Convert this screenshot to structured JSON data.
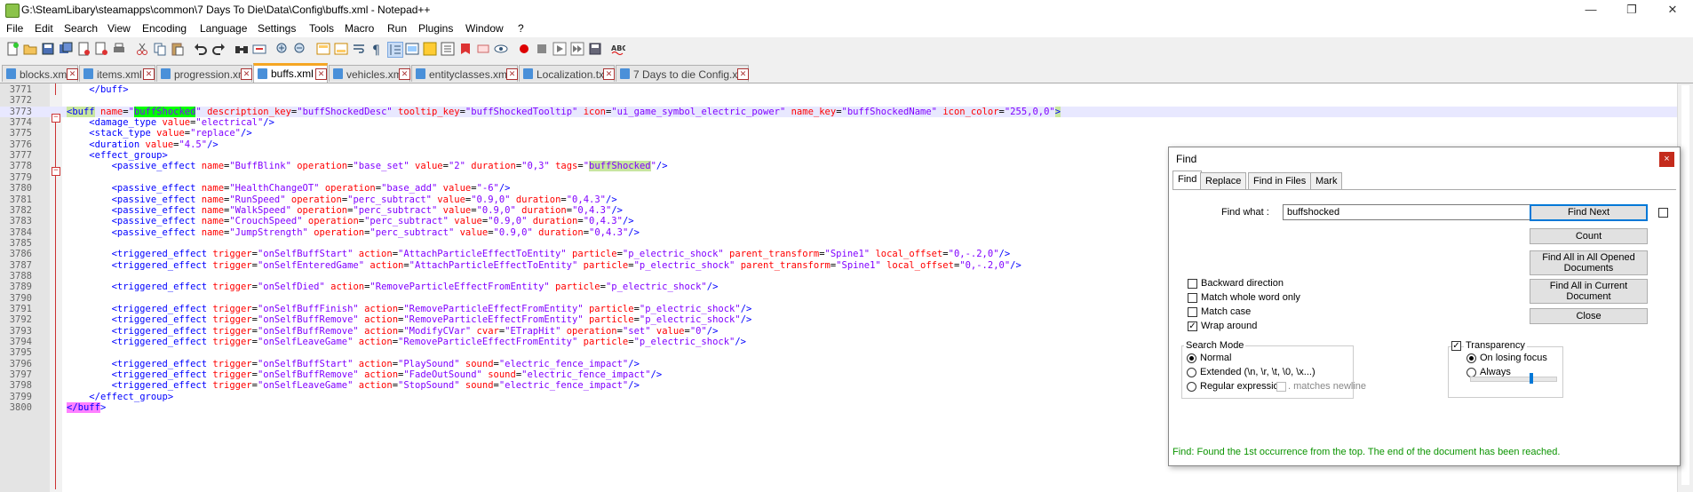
{
  "window": {
    "title": "G:\\SteamLibary\\steamapps\\common\\7 Days To Die\\Data\\Config\\buffs.xml - Notepad++",
    "controls": [
      "—",
      "❐",
      "✕"
    ]
  },
  "menu": [
    "File",
    "Edit",
    "Search",
    "View",
    "Encoding",
    "Language",
    "Settings",
    "Tools",
    "Macro",
    "Run",
    "Plugins",
    "Window",
    "?"
  ],
  "tabs": [
    {
      "label": "blocks.xml"
    },
    {
      "label": "items.xml"
    },
    {
      "label": "progression.xml"
    },
    {
      "label": "buffs.xml",
      "active": true
    },
    {
      "label": "vehicles.xml"
    },
    {
      "label": "entityclasses.xml"
    },
    {
      "label": "Localization.txt"
    },
    {
      "label": "7 Days to die Config.xml"
    }
  ],
  "editor": {
    "lines": [
      {
        "n": "3771",
        "text": "    </buff>"
      },
      {
        "n": "3772",
        "text": ""
      },
      {
        "n": "3773",
        "text": "<buff name=\"buffShocked\" description_key=\"buffShockedDesc\" tooltip_key=\"buffShockedTooltip\" icon=\"ui_game_symbol_electric_power\" name_key=\"buffShockedName\" icon_color=\"255,0,0\">"
      },
      {
        "n": "3774",
        "text": "    <damage_type value=\"electrical\"/>"
      },
      {
        "n": "3775",
        "text": "    <stack_type value=\"replace\"/>"
      },
      {
        "n": "3776",
        "text": "    <duration value=\"4.5\"/>"
      },
      {
        "n": "3777",
        "text": "    <effect_group>"
      },
      {
        "n": "3778",
        "text": "        <passive_effect name=\"BuffBlink\" operation=\"base_set\" value=\"2\" duration=\"0,3\" tags=\"buffShocked\"/>"
      },
      {
        "n": "3779",
        "text": ""
      },
      {
        "n": "3780",
        "text": "        <passive_effect name=\"HealthChangeOT\" operation=\"base_add\" value=\"-6\"/>"
      },
      {
        "n": "3781",
        "text": "        <passive_effect name=\"RunSpeed\" operation=\"perc_subtract\" value=\"0.9,0\" duration=\"0,4.3\"/>"
      },
      {
        "n": "3782",
        "text": "        <passive_effect name=\"WalkSpeed\" operation=\"perc_subtract\" value=\"0.9,0\" duration=\"0,4.3\"/>"
      },
      {
        "n": "3783",
        "text": "        <passive_effect name=\"CrouchSpeed\" operation=\"perc_subtract\" value=\"0.9,0\" duration=\"0,4.3\"/>"
      },
      {
        "n": "3784",
        "text": "        <passive_effect name=\"JumpStrength\" operation=\"perc_subtract\" value=\"0.9,0\" duration=\"0,4.3\"/>"
      },
      {
        "n": "3785",
        "text": ""
      },
      {
        "n": "3786",
        "text": "        <triggered_effect trigger=\"onSelfBuffStart\" action=\"AttachParticleEffectToEntity\" particle=\"p_electric_shock\" parent_transform=\"Spine1\" local_offset=\"0,-.2,0\"/>"
      },
      {
        "n": "3787",
        "text": "        <triggered_effect trigger=\"onSelfEnteredGame\" action=\"AttachParticleEffectToEntity\" particle=\"p_electric_shock\" parent_transform=\"Spine1\" local_offset=\"0,-.2,0\"/>"
      },
      {
        "n": "3788",
        "text": ""
      },
      {
        "n": "3789",
        "text": "        <triggered_effect trigger=\"onSelfDied\" action=\"RemoveParticleEffectFromEntity\" particle=\"p_electric_shock\"/>"
      },
      {
        "n": "3790",
        "text": ""
      },
      {
        "n": "3791",
        "text": "        <triggered_effect trigger=\"onSelfBuffFinish\" action=\"RemoveParticleEffectFromEntity\" particle=\"p_electric_shock\"/>"
      },
      {
        "n": "3792",
        "text": "        <triggered_effect trigger=\"onSelfBuffRemove\" action=\"RemoveParticleEffectFromEntity\" particle=\"p_electric_shock\"/>"
      },
      {
        "n": "3793",
        "text": "        <triggered_effect trigger=\"onSelfBuffRemove\" action=\"ModifyCVar\" cvar=\"ETrapHit\" operation=\"set\" value=\"0\"/>"
      },
      {
        "n": "3794",
        "text": "        <triggered_effect trigger=\"onSelfLeaveGame\" action=\"RemoveParticleEffectFromEntity\" particle=\"p_electric_shock\"/>"
      },
      {
        "n": "3795",
        "text": ""
      },
      {
        "n": "3796",
        "text": "        <triggered_effect trigger=\"onSelfBuffStart\" action=\"PlaySound\" sound=\"electric_fence_impact\"/>"
      },
      {
        "n": "3797",
        "text": "        <triggered_effect trigger=\"onSelfBuffRemove\" action=\"FadeOutSound\" sound=\"electric_fence_impact\"/>"
      },
      {
        "n": "3798",
        "text": "        <triggered_effect trigger=\"onSelfLeaveGame\" action=\"StopSound\" sound=\"electric_fence_impact\"/>"
      },
      {
        "n": "3799",
        "text": "    </effect_group>"
      },
      {
        "n": "3800",
        "text": "</buff>"
      }
    ]
  },
  "find_dialog": {
    "title": "Find",
    "close": "×",
    "tabs": [
      "Find",
      "Replace",
      "Find in Files",
      "Mark"
    ],
    "find_what_label": "Find what :",
    "find_what_value": "buffshocked",
    "buttons": {
      "find_next": "Find Next",
      "count": "Count",
      "find_all_opened_1": "Find All in All Opened",
      "find_all_opened_2": "Documents",
      "find_all_current_1": "Find All in Current",
      "find_all_current_2": "Document",
      "close": "Close"
    },
    "options": {
      "backward": "Backward direction",
      "whole_word": "Match whole word only",
      "match_case": "Match case",
      "wrap_around": "Wrap around"
    },
    "search_mode": {
      "title": "Search Mode",
      "normal": "Normal",
      "extended": "Extended (\\n, \\r, \\t, \\0, \\x...)",
      "regex": "Regular expression",
      "matches_newline": ". matches newline"
    },
    "transparency": {
      "title": "Transparency",
      "on_losing_focus": "On losing focus",
      "always": "Always",
      "level": 0.72
    },
    "status": "Find: Found the 1st occurrence from the top. The end of the document has been reached.",
    "colors": {
      "status": "#0b9400",
      "accent": "#0078d7"
    }
  }
}
